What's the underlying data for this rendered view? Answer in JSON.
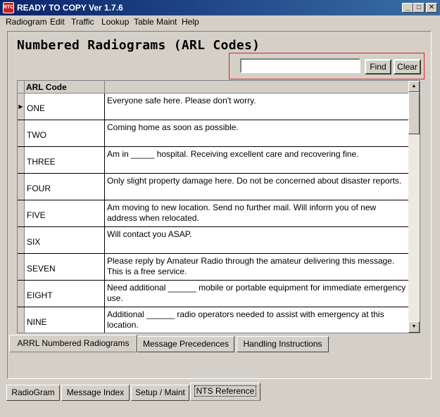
{
  "window": {
    "title": "READY TO COPY Ver 1.7.6",
    "icon_label": "RTC"
  },
  "window_buttons": {
    "minimize": "_",
    "maximize": "□",
    "close": "✕"
  },
  "menu": [
    {
      "label": "Radiogram"
    },
    {
      "label": "Edit"
    },
    {
      "label": "Traffic"
    },
    {
      "label": "Lookup"
    },
    {
      "label": "Table Maint"
    },
    {
      "label": "Help"
    }
  ],
  "page": {
    "title": "Numbered Radiograms (ARL Codes)"
  },
  "search": {
    "value": "",
    "find_label": "Find",
    "clear_label": "Clear"
  },
  "grid": {
    "columns": [
      "ARL Code",
      ""
    ],
    "current_row_marker": "▶",
    "rows": [
      {
        "code": "ONE",
        "message": "Everyone safe here. Please don't worry."
      },
      {
        "code": "TWO",
        "message": "Coming home as soon as possible."
      },
      {
        "code": "THREE",
        "message": "Am in _____ hospital. Receiving excellent care and recovering fine."
      },
      {
        "code": "FOUR",
        "message": "Only slight property damage here. Do not be concerned about disaster reports."
      },
      {
        "code": "FIVE",
        "message": "Am moving to new location. Send no further mail. Will inform you of new address when relocated."
      },
      {
        "code": "SIX",
        "message": "Will contact you ASAP."
      },
      {
        "code": "SEVEN",
        "message": "Please reply by Amateur Radio through the amateur delivering this message. This is a free service."
      },
      {
        "code": "EIGHT",
        "message": "Need additional ______ mobile or portable equipment for immediate emergency use."
      },
      {
        "code": "NINE",
        "message": "Additional ______ radio operators needed to assist with emergency at this location."
      }
    ]
  },
  "inner_tabs": [
    {
      "label": "ARRL Numbered Radiograms",
      "active": true
    },
    {
      "label": "Message Precedences",
      "active": false
    },
    {
      "label": "Handling Instructions",
      "active": false
    }
  ],
  "outer_tabs": [
    {
      "label": "RadioGram",
      "active": false
    },
    {
      "label": "Message Index",
      "active": false
    },
    {
      "label": "Setup / Maint",
      "active": false
    },
    {
      "label": "NTS Reference",
      "active": true
    }
  ],
  "colors": {
    "title_bar": "#0a246a",
    "find_highlight": "#e02020",
    "face": "#d4d0c8"
  }
}
